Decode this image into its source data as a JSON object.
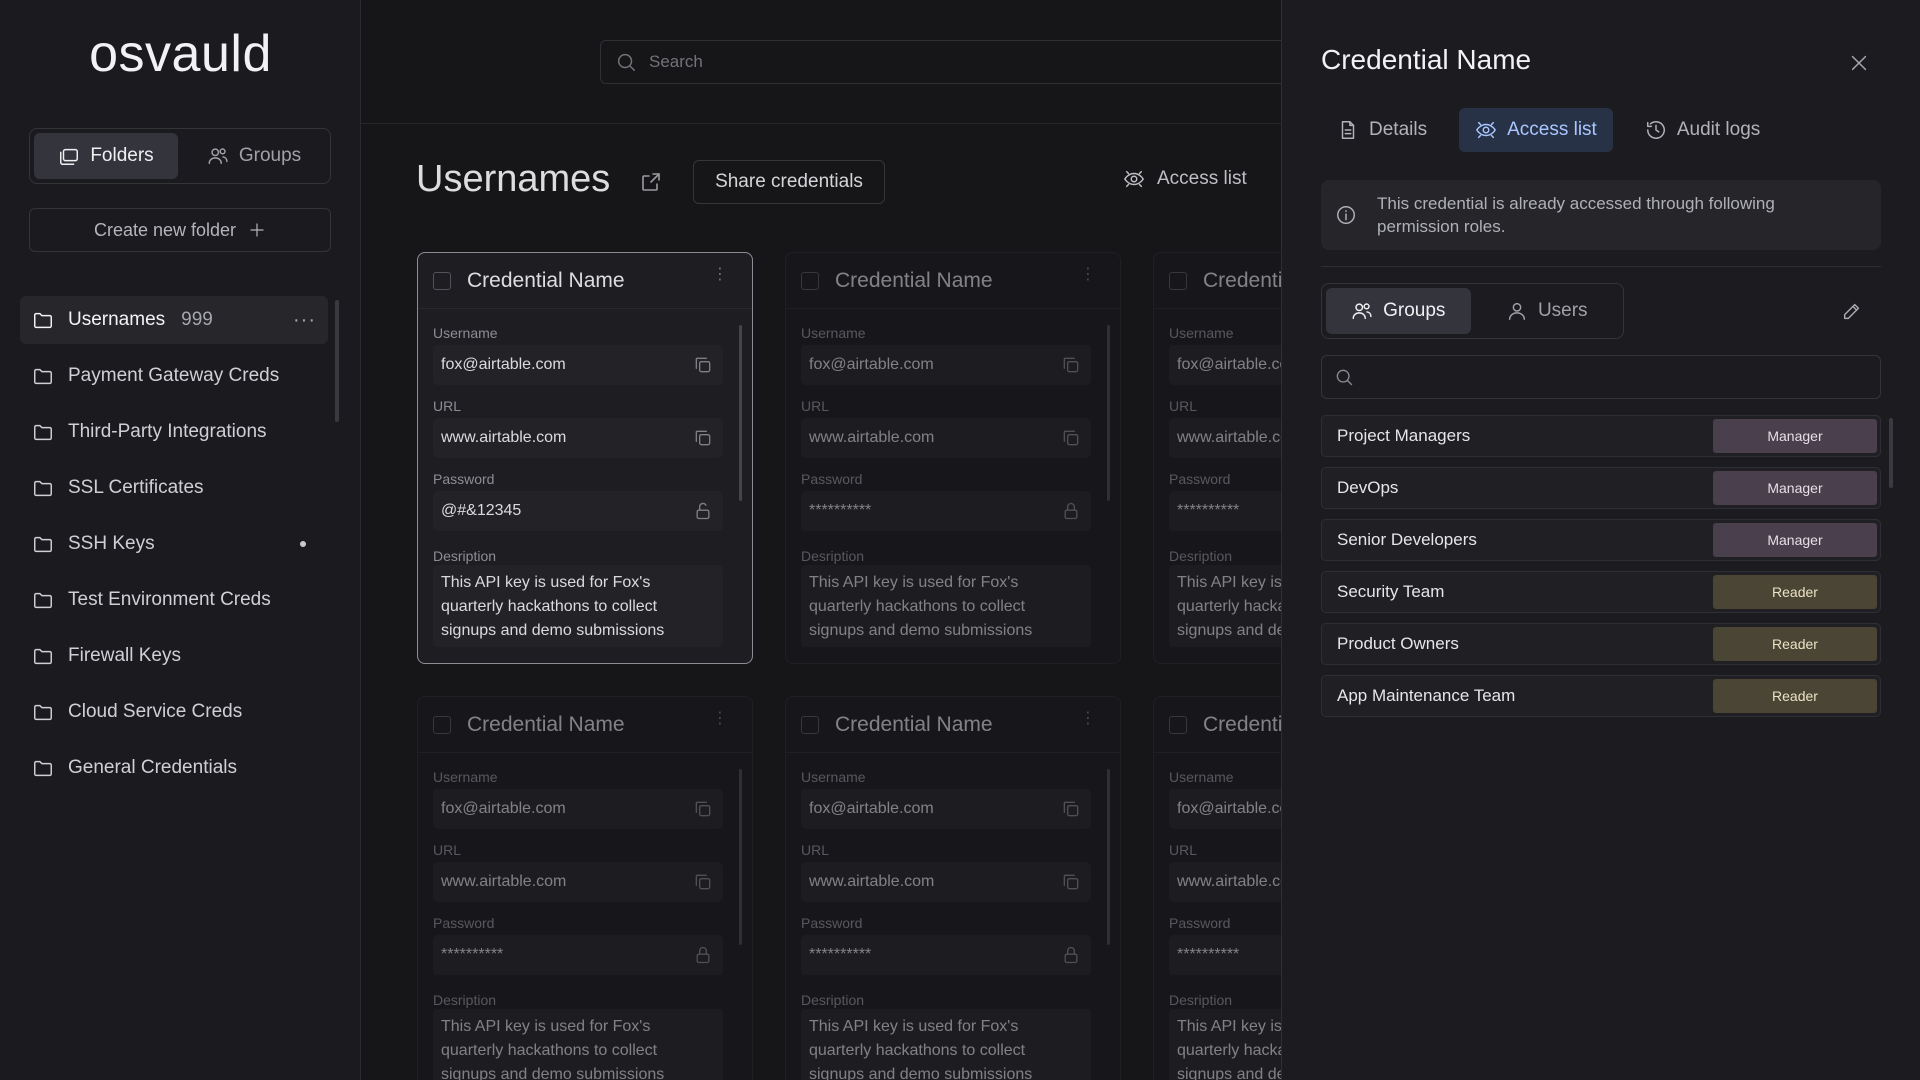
{
  "app": {
    "logo": "osvauld"
  },
  "sidebar": {
    "tabs": [
      {
        "label": "Folders",
        "icon": "folder-stack-icon",
        "active": true
      },
      {
        "label": "Groups",
        "icon": "users-icon",
        "active": false
      }
    ],
    "create_folder_label": "Create new folder",
    "folders": [
      {
        "label": "Usernames",
        "count": "999",
        "active": true
      },
      {
        "label": "Payment Gateway Creds"
      },
      {
        "label": "Third-Party Integrations"
      },
      {
        "label": "SSL Certificates"
      },
      {
        "label": "SSH Keys",
        "has_dot": true
      },
      {
        "label": "Test Environment Creds"
      },
      {
        "label": "Firewall Keys"
      },
      {
        "label": "Cloud Service Creds"
      },
      {
        "label": "General Credentials"
      }
    ]
  },
  "main": {
    "search_placeholder": "Search",
    "title": "Usernames",
    "share_label": "Share credentials",
    "access_list_label": "Access list",
    "card": {
      "title": "Credential Name",
      "username_label": "Username",
      "username": "fox@airtable.com",
      "url_label": "URL",
      "url": "www.airtable.com",
      "password_label": "Password",
      "password_visible": "@#&12345",
      "password_masked": "**********",
      "description_label": "Desription",
      "description": "This API key is used for Fox's quarterly hackathons to collect signups and demo submissions"
    }
  },
  "panel": {
    "title": "Credential Name",
    "tabs": [
      {
        "label": "Details",
        "active": false
      },
      {
        "label": "Access list",
        "active": true
      },
      {
        "label": "Audit logs",
        "active": false
      }
    ],
    "notice": "This credential is already accessed through following permission roles.",
    "segment": [
      {
        "label": "Groups",
        "active": true
      },
      {
        "label": "Users",
        "active": false
      }
    ],
    "roles": [
      {
        "name": "Project Managers",
        "role": "Manager"
      },
      {
        "name": "DevOps",
        "role": "Manager"
      },
      {
        "name": "Senior Developers",
        "role": "Manager"
      },
      {
        "name": "Security Team",
        "role": "Reader"
      },
      {
        "name": "Product Owners",
        "role": "Reader"
      },
      {
        "name": "App Maintenance Team",
        "role": "Reader"
      }
    ]
  }
}
